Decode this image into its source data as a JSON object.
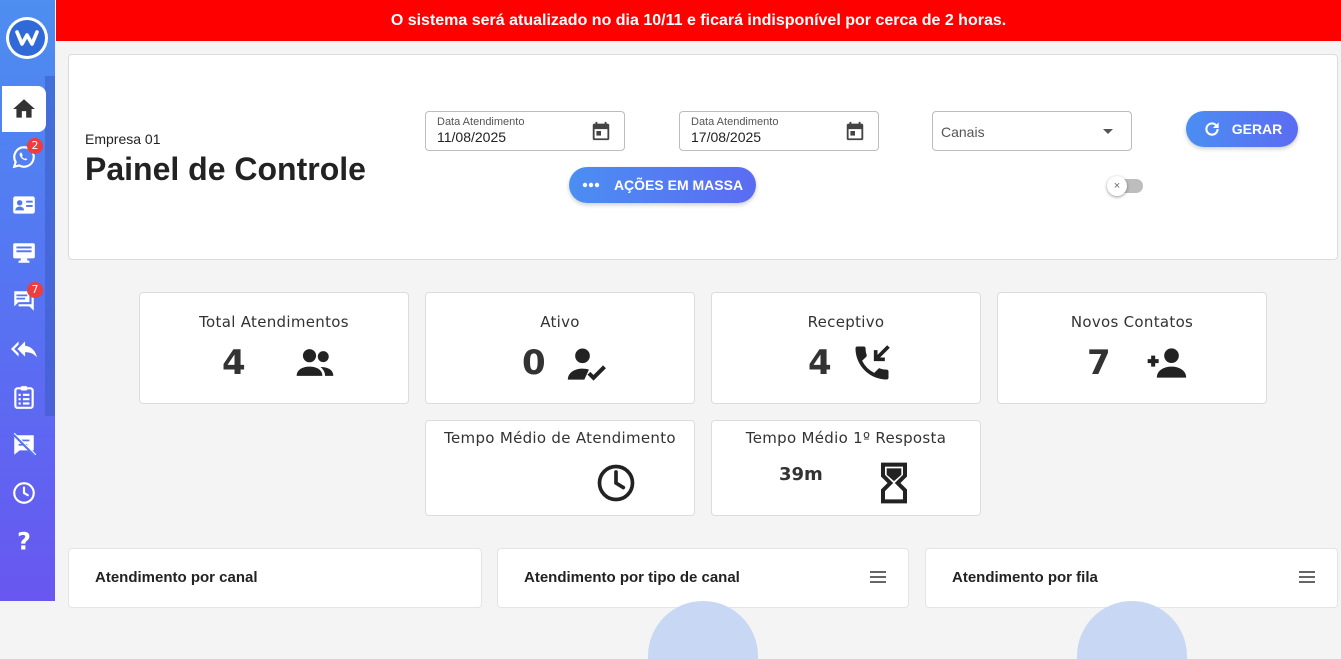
{
  "banner": {
    "text": "O sistema será atualizado no dia 10/11 e ficará indisponível por cerca de 2 horas."
  },
  "sidebar": {
    "items": [
      {
        "name": "home",
        "icon": "home-icon",
        "active": true
      },
      {
        "name": "whatsapp",
        "icon": "whatsapp-icon",
        "badge": "2"
      },
      {
        "name": "contacts",
        "icon": "contact-card-icon"
      },
      {
        "name": "monitor",
        "icon": "monitor-icon"
      },
      {
        "name": "chats",
        "icon": "chat-icon",
        "badge": "7"
      },
      {
        "name": "reply-all",
        "icon": "reply-all-icon"
      },
      {
        "name": "tasks",
        "icon": "clipboard-icon"
      },
      {
        "name": "no-messages",
        "icon": "speaker-notes-off-icon"
      },
      {
        "name": "history",
        "icon": "clock-icon"
      },
      {
        "name": "help",
        "icon": "help-icon"
      }
    ]
  },
  "header": {
    "company": "Empresa 01",
    "title": "Painel de Controle",
    "date_start": {
      "label": "Data Atendimento",
      "value": "11/08/2025"
    },
    "date_end": {
      "label": "Data Atendimento",
      "value": "17/08/2025"
    },
    "channels": {
      "placeholder": "Canais"
    },
    "gerar_label": "GERAR",
    "acoes_label": "AÇÕES EM MASSA",
    "toggle_icon": "×"
  },
  "stats": {
    "total": {
      "title": "Total Atendimentos",
      "value": "4",
      "icon": "group-icon"
    },
    "ativo": {
      "title": "Ativo",
      "value": "0",
      "icon": "person-check-icon"
    },
    "receptivo": {
      "title": "Receptivo",
      "value": "4",
      "icon": "phone-callback-icon"
    },
    "novos": {
      "title": "Novos Contatos",
      "value": "7",
      "icon": "person-add-icon"
    },
    "tempo_medio": {
      "title": "Tempo Médio de Atendimento",
      "value": "",
      "icon": "clock-icon"
    },
    "tempo_resposta": {
      "title": "Tempo Médio 1º Resposta",
      "value": "39m",
      "icon": "hourglass-icon"
    }
  },
  "charts": {
    "canal": {
      "title": "Atendimento por canal"
    },
    "tipo_canal": {
      "title": "Atendimento por tipo de canal"
    },
    "fila": {
      "title": "Atendimento por fila"
    }
  },
  "colors": {
    "banner": "#ff0000",
    "accent": "#5576f2",
    "badge": "#f03c3c"
  }
}
